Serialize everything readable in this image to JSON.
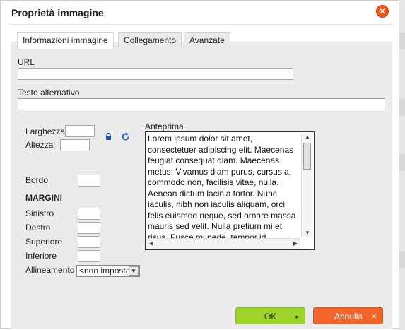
{
  "dialog": {
    "title": "Proprietà immagine",
    "close_symbol": "✕",
    "tabs": [
      {
        "label": "Informazioni immagine",
        "active": true
      },
      {
        "label": "Collegamento",
        "active": false
      },
      {
        "label": "Avanzate",
        "active": false
      }
    ]
  },
  "form": {
    "url_label": "URL",
    "url_value": "",
    "alt_label": "Testo alternativo",
    "alt_value": "",
    "width_label": "Larghezza",
    "width_value": "",
    "height_label": "Altezza",
    "height_value": "",
    "lock_icon": "lock-icon",
    "reset_icon": "reset-size-icon",
    "border_label": "Bordo",
    "border_value": "",
    "margins_heading": "MARGINI",
    "left_label": "Sinistro",
    "right_label": "Destro",
    "top_label": "Superiore",
    "bottom_label": "Inferiore",
    "align_label": "Allineamento",
    "align_selected": "<non impostato>"
  },
  "preview": {
    "label": "Anteprima",
    "text": "Lorem ipsum dolor sit amet, consectetuer adipiscing elit. Maecenas feugiat consequat diam. Maecenas metus. Vivamus diam purus, cursus a, commodo non, facilisis vitae, nulla. Aenean dictum lacinia tortor. Nunc iaculis, nibh non iaculis aliquam, orci felis euismod neque, sed ornare massa mauris sed velit. Nulla pretium mi et risus. Fusce mi pede, tempor id"
  },
  "footer": {
    "ok_label": "OK",
    "cancel_label": "Annulla"
  },
  "colors": {
    "ok": "#9ed42a",
    "cancel": "#f0662a",
    "close": "#e85a20"
  }
}
